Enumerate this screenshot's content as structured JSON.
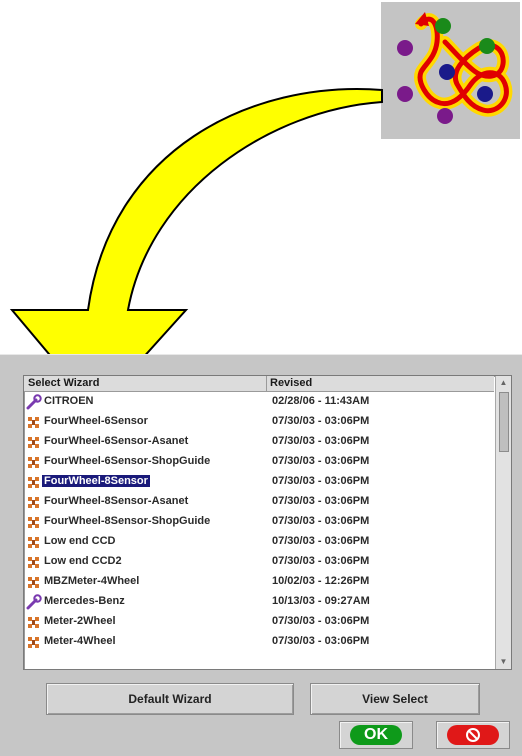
{
  "list": {
    "col_name": "Select Wizard",
    "col_revised": "Revised",
    "rows": [
      {
        "name": "CITROEN",
        "revised": "02/28/06 - 11:43AM",
        "icon": "wrench-icon"
      },
      {
        "name": "FourWheel-6Sensor",
        "revised": "07/30/03 - 03:06PM",
        "icon": "wheel-icon"
      },
      {
        "name": "FourWheel-6Sensor-Asanet",
        "revised": "07/30/03 - 03:06PM",
        "icon": "wheel-icon"
      },
      {
        "name": "FourWheel-6Sensor-ShopGuide",
        "revised": "07/30/03 - 03:06PM",
        "icon": "wheel-icon"
      },
      {
        "name": "FourWheel-8Sensor",
        "revised": "07/30/03 - 03:06PM",
        "icon": "wheel-icon",
        "selected": true
      },
      {
        "name": "FourWheel-8Sensor-Asanet",
        "revised": "07/30/03 - 03:06PM",
        "icon": "wheel-icon"
      },
      {
        "name": "FourWheel-8Sensor-ShopGuide",
        "revised": "07/30/03 - 03:06PM",
        "icon": "wheel-icon"
      },
      {
        "name": "Low end CCD",
        "revised": "07/30/03 - 03:06PM",
        "icon": "wheel-icon"
      },
      {
        "name": "Low end CCD2",
        "revised": "07/30/03 - 03:06PM",
        "icon": "wheel-icon"
      },
      {
        "name": "MBZMeter-4Wheel",
        "revised": "10/02/03 - 12:26PM",
        "icon": "wheel-icon"
      },
      {
        "name": "Mercedes-Benz",
        "revised": "10/13/03 - 09:27AM",
        "icon": "wrench-icon"
      },
      {
        "name": "Meter-2Wheel",
        "revised": "07/30/03 - 03:06PM",
        "icon": "wheel-icon"
      },
      {
        "name": "Meter-4Wheel",
        "revised": "07/30/03 - 03:06PM",
        "icon": "wheel-icon"
      }
    ]
  },
  "buttons": {
    "default_wizard": "Default Wizard",
    "view_select": "View Select",
    "ok": "OK"
  },
  "colors": {
    "arrow_fill": "#ffff00",
    "selection_bg": "#1a1a7a",
    "ok_green": "#0e9a1a",
    "cancel_red": "#e01818"
  }
}
